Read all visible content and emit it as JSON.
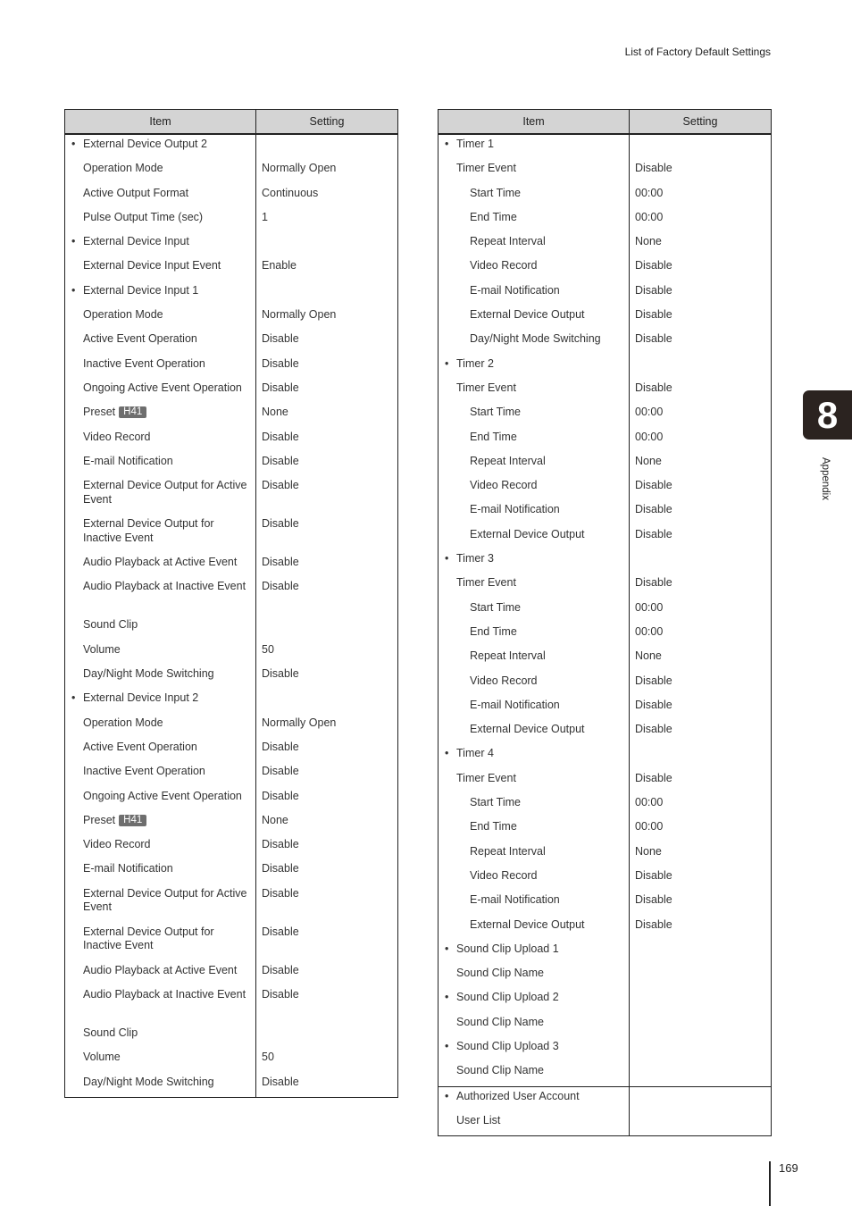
{
  "running_head": "List of Factory Default Settings",
  "chapter": {
    "number": "8",
    "label": "Appendix"
  },
  "page_number": "169",
  "header": {
    "item": "Item",
    "setting": "Setting"
  },
  "left_table": [
    {
      "level": 0,
      "item": "External Device Output 2",
      "setting": ""
    },
    {
      "level": 1,
      "item": "Operation Mode",
      "setting": "Normally Open"
    },
    {
      "level": 1,
      "item": "Active Output Format",
      "setting": "Continuous"
    },
    {
      "level": 1,
      "item": "Pulse Output Time (sec)",
      "setting": "1"
    },
    {
      "level": 0,
      "item": "External Device Input",
      "setting": ""
    },
    {
      "level": 1,
      "item": "External Device Input Event",
      "setting": "Enable"
    },
    {
      "level": 0,
      "item": "External Device Input 1",
      "setting": ""
    },
    {
      "level": 1,
      "item": "Operation Mode",
      "setting": "Normally Open"
    },
    {
      "level": 1,
      "item": "Active Event Operation",
      "setting": "Disable"
    },
    {
      "level": 1,
      "item": "Inactive Event Operation",
      "setting": "Disable"
    },
    {
      "level": 1,
      "item": "Ongoing Active Event Operation",
      "setting": "Disable"
    },
    {
      "level": 1,
      "item": "Preset",
      "badge": "H41",
      "setting": "None"
    },
    {
      "level": 1,
      "item": "Video Record",
      "setting": "Disable"
    },
    {
      "level": 1,
      "item": "E-mail Notification",
      "setting": "Disable"
    },
    {
      "level": 1,
      "item": "External Device Output for Active Event",
      "setting": "Disable",
      "two_line": true
    },
    {
      "level": 1,
      "item": "External Device Output for Inactive Event",
      "setting": "Disable",
      "two_line": true
    },
    {
      "level": 1,
      "item": "Audio Playback at Active Event",
      "setting": "Disable"
    },
    {
      "level": 1,
      "item": "Audio Playback at Inactive Event",
      "setting": "Disable",
      "two_line": true
    },
    {
      "level": 1,
      "item": "Sound Clip",
      "setting": ""
    },
    {
      "level": 1,
      "item": "Volume",
      "setting": "50"
    },
    {
      "level": 1,
      "item": "Day/Night Mode Switching",
      "setting": "Disable"
    },
    {
      "level": 0,
      "item": "External Device Input 2",
      "setting": ""
    },
    {
      "level": 1,
      "item": "Operation Mode",
      "setting": "Normally Open"
    },
    {
      "level": 1,
      "item": "Active Event Operation",
      "setting": "Disable"
    },
    {
      "level": 1,
      "item": "Inactive Event Operation",
      "setting": "Disable"
    },
    {
      "level": 1,
      "item": "Ongoing Active Event Operation",
      "setting": "Disable"
    },
    {
      "level": 1,
      "item": "Preset",
      "badge": "H41",
      "setting": "None"
    },
    {
      "level": 1,
      "item": "Video Record",
      "setting": "Disable"
    },
    {
      "level": 1,
      "item": "E-mail Notification",
      "setting": "Disable"
    },
    {
      "level": 1,
      "item": "External Device Output for Active Event",
      "setting": "Disable",
      "two_line": true
    },
    {
      "level": 1,
      "item": "External Device Output for Inactive Event",
      "setting": "Disable",
      "two_line": true
    },
    {
      "level": 1,
      "item": "Audio Playback at Active Event",
      "setting": "Disable"
    },
    {
      "level": 1,
      "item": "Audio Playback at Inactive Event",
      "setting": "Disable",
      "two_line": true
    },
    {
      "level": 1,
      "item": "Sound Clip",
      "setting": ""
    },
    {
      "level": 1,
      "item": "Volume",
      "setting": "50"
    },
    {
      "level": 1,
      "item": "Day/Night Mode Switching",
      "setting": "Disable"
    }
  ],
  "right_table": [
    {
      "level": 0,
      "item": "Timer 1",
      "setting": ""
    },
    {
      "level": 1,
      "item": "Timer Event",
      "setting": "Disable"
    },
    {
      "level": 2,
      "item": "Start Time",
      "setting": "00:00"
    },
    {
      "level": 2,
      "item": "End Time",
      "setting": "00:00"
    },
    {
      "level": 2,
      "item": "Repeat Interval",
      "setting": "None"
    },
    {
      "level": 2,
      "item": "Video Record",
      "setting": "Disable"
    },
    {
      "level": 2,
      "item": "E-mail Notification",
      "setting": "Disable"
    },
    {
      "level": 2,
      "item": "External Device Output",
      "setting": "Disable"
    },
    {
      "level": 2,
      "item": "Day/Night Mode Switching",
      "setting": "Disable"
    },
    {
      "level": 0,
      "item": "Timer 2",
      "setting": ""
    },
    {
      "level": 1,
      "item": "Timer Event",
      "setting": "Disable"
    },
    {
      "level": 2,
      "item": "Start Time",
      "setting": "00:00"
    },
    {
      "level": 2,
      "item": "End Time",
      "setting": "00:00"
    },
    {
      "level": 2,
      "item": "Repeat Interval",
      "setting": "None"
    },
    {
      "level": 2,
      "item": "Video Record",
      "setting": "Disable"
    },
    {
      "level": 2,
      "item": "E-mail Notification",
      "setting": "Disable"
    },
    {
      "level": 2,
      "item": "External Device Output",
      "setting": "Disable"
    },
    {
      "level": 0,
      "item": "Timer 3",
      "setting": ""
    },
    {
      "level": 1,
      "item": "Timer Event",
      "setting": "Disable"
    },
    {
      "level": 2,
      "item": "Start Time",
      "setting": "00:00"
    },
    {
      "level": 2,
      "item": "End Time",
      "setting": "00:00"
    },
    {
      "level": 2,
      "item": "Repeat Interval",
      "setting": "None"
    },
    {
      "level": 2,
      "item": "Video Record",
      "setting": "Disable"
    },
    {
      "level": 2,
      "item": "E-mail Notification",
      "setting": "Disable"
    },
    {
      "level": 2,
      "item": "External Device Output",
      "setting": "Disable"
    },
    {
      "level": 0,
      "item": "Timer 4",
      "setting": ""
    },
    {
      "level": 1,
      "item": "Timer Event",
      "setting": "Disable"
    },
    {
      "level": 2,
      "item": "Start Time",
      "setting": "00:00"
    },
    {
      "level": 2,
      "item": "End Time",
      "setting": "00:00"
    },
    {
      "level": 2,
      "item": "Repeat Interval",
      "setting": "None"
    },
    {
      "level": 2,
      "item": "Video Record",
      "setting": "Disable"
    },
    {
      "level": 2,
      "item": "E-mail Notification",
      "setting": "Disable"
    },
    {
      "level": 2,
      "item": "External Device Output",
      "setting": "Disable"
    },
    {
      "level": 0,
      "item": "Sound Clip Upload 1",
      "setting": ""
    },
    {
      "level": 1,
      "item": "Sound Clip Name",
      "setting": ""
    },
    {
      "level": 0,
      "item": "Sound Clip Upload 2",
      "setting": ""
    },
    {
      "level": 1,
      "item": "Sound Clip Name",
      "setting": ""
    },
    {
      "level": 0,
      "item": "Sound Clip Upload 3",
      "setting": ""
    },
    {
      "level": 1,
      "item": "Sound Clip Name",
      "setting": ""
    },
    {
      "level": 0,
      "item": "Authorized User Account",
      "setting": "",
      "group_start": true
    },
    {
      "level": 1,
      "item": "User List",
      "setting": ""
    }
  ]
}
